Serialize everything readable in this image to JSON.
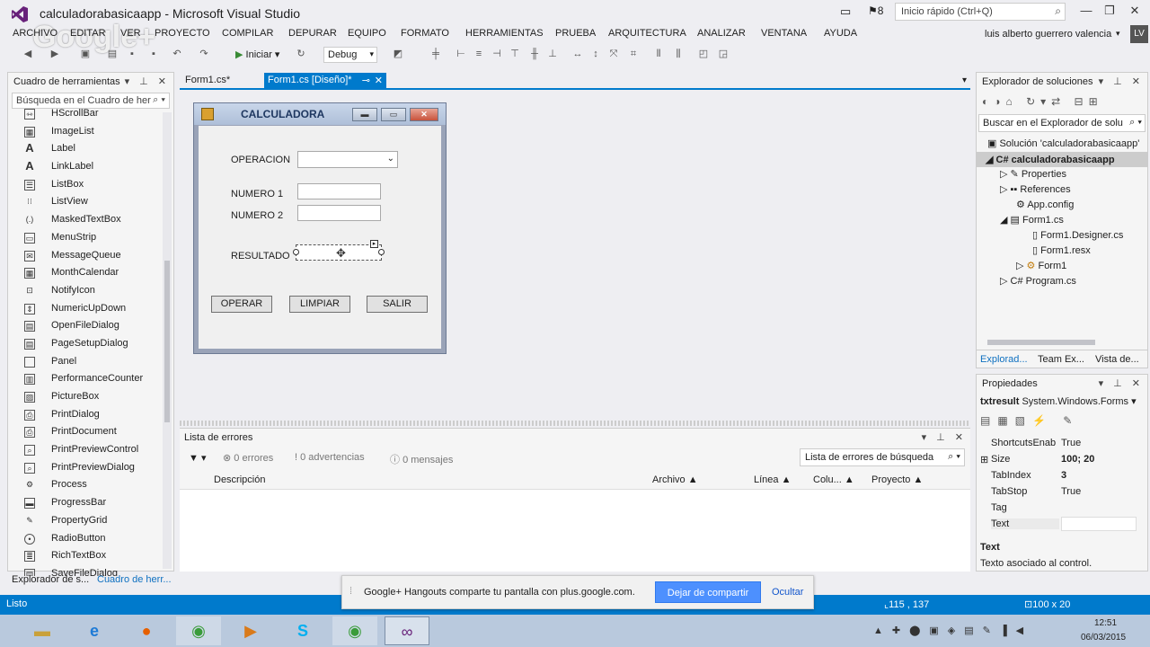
{
  "window": {
    "title": "calculadorabasicaapp - Microsoft Visual Studio",
    "quick_launch_placeholder": "Inicio rápido (Ctrl+Q)",
    "notifications": "8",
    "user": "luis alberto guerrero valencia",
    "avatar": "LV",
    "watermark": "Google+"
  },
  "menu": [
    "ARCHIVO",
    "EDITAR",
    "VER",
    "PROYECTO",
    "COMPILAR",
    "DEPURAR",
    "EQUIPO",
    "FORMATO",
    "HERRAMIENTAS",
    "PRUEBA",
    "ARQUITECTURA",
    "ANALIZAR",
    "VENTANA",
    "AYUDA"
  ],
  "toolbar": {
    "start_label": "Iniciar",
    "config": "Debug"
  },
  "toolbox": {
    "title": "Cuadro de herramientas",
    "search_placeholder": "Búsqueda en el Cuadro de her",
    "items": [
      "HScrollBar",
      "ImageList",
      "Label",
      "LinkLabel",
      "ListBox",
      "ListView",
      "MaskedTextBox",
      "MenuStrip",
      "MessageQueue",
      "MonthCalendar",
      "NotifyIcon",
      "NumericUpDown",
      "OpenFileDialog",
      "PageSetupDialog",
      "Panel",
      "PerformanceCounter",
      "PictureBox",
      "PrintDialog",
      "PrintDocument",
      "PrintPreviewControl",
      "PrintPreviewDialog",
      "Process",
      "ProgressBar",
      "PropertyGrid",
      "RadioButton",
      "RichTextBox",
      "SaveFileDialog"
    ],
    "bottom_tabs": [
      "Explorador de s...",
      "Cuadro de herr..."
    ]
  },
  "doc_tabs": [
    {
      "label": "Form1.cs*"
    },
    {
      "label": "Form1.cs [Diseño]*"
    }
  ],
  "form": {
    "title": "CALCULADORA",
    "label_operacion": "OPERACION",
    "label_numero1": "NUMERO 1",
    "label_numero2": "NUMERO 2",
    "label_resultado": "RESULTADO",
    "btn_operar": "OPERAR",
    "btn_limpiar": "LIMPIAR",
    "btn_salir": "SALIR"
  },
  "error_list": {
    "title": "Lista de errores",
    "errors": "0 errores",
    "warnings": "0 advertencias",
    "messages": "0 mensajes",
    "search_placeholder": "Lista de errores de búsqueda",
    "columns": [
      "Descripción",
      "Archivo",
      "Línea",
      "Colu...",
      "Proyecto"
    ]
  },
  "solution_explorer": {
    "title": "Explorador de soluciones",
    "search_placeholder": "Buscar en el Explorador de solu",
    "tree": [
      {
        "label": "Solución 'calculadorabasicaapp'"
      },
      {
        "label": "calculadorabasicaapp"
      },
      {
        "label": "Properties"
      },
      {
        "label": "References"
      },
      {
        "label": "App.config"
      },
      {
        "label": "Form1.cs"
      },
      {
        "label": "Form1.Designer.cs"
      },
      {
        "label": "Form1.resx"
      },
      {
        "label": "Form1"
      },
      {
        "label": "Program.cs"
      }
    ],
    "tabs": [
      "Explorad...",
      "Team Ex...",
      "Vista de..."
    ]
  },
  "properties": {
    "title": "Propiedades",
    "object": "txtresult",
    "object_type": "System.Windows.Forms",
    "rows": [
      {
        "name": "ShortcutsEnab",
        "value": "True"
      },
      {
        "name": "Size",
        "value": "100; 20"
      },
      {
        "name": "TabIndex",
        "value": "3"
      },
      {
        "name": "TabStop",
        "value": "True"
      },
      {
        "name": "Tag",
        "value": ""
      },
      {
        "name": "Text",
        "value": ""
      }
    ],
    "desc_title": "Text",
    "desc_text": "Texto asociado al control."
  },
  "status": {
    "text": "Listo",
    "coords": "115 , 137",
    "size": "100 x 20"
  },
  "hangouts": {
    "message": "Google+ Hangouts comparte tu pantalla con plus.google.com.",
    "stop_button": "Dejar de compartir",
    "hide_button": "Ocultar"
  },
  "taskbar": {
    "time": "12:51",
    "date": "06/03/2015"
  }
}
